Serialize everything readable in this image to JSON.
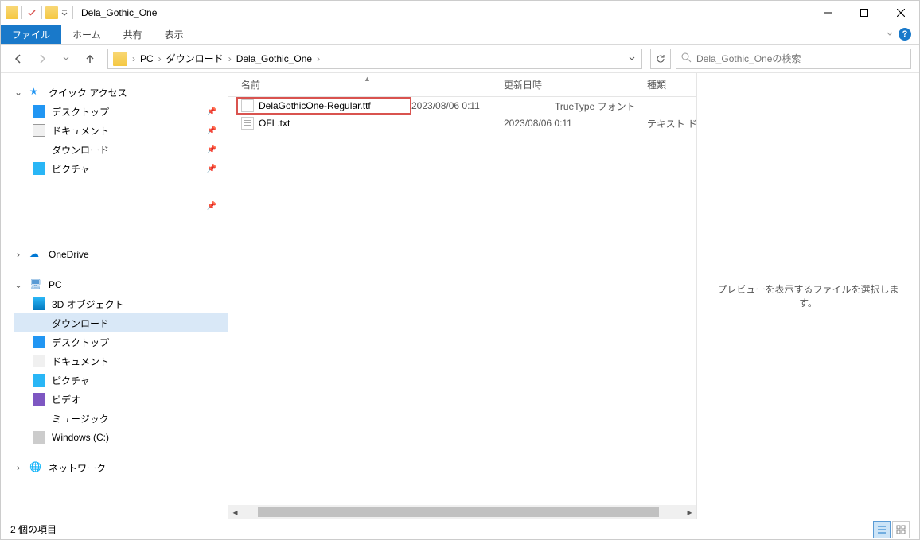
{
  "window": {
    "title": "Dela_Gothic_One"
  },
  "ribbon": {
    "file": "ファイル",
    "tabs": [
      "ホーム",
      "共有",
      "表示"
    ]
  },
  "address": {
    "crumbs": [
      "PC",
      "ダウンロード",
      "Dela_Gothic_One"
    ]
  },
  "search": {
    "placeholder": "Dela_Gothic_Oneの検索"
  },
  "nav": {
    "quick_access": "クイック アクセス",
    "quick_items": [
      {
        "label": "デスクトップ",
        "icon": "desktop",
        "pin": true
      },
      {
        "label": "ドキュメント",
        "icon": "doc",
        "pin": true
      },
      {
        "label": "ダウンロード",
        "icon": "dl",
        "pin": true
      },
      {
        "label": "ピクチャ",
        "icon": "pic",
        "pin": true
      }
    ],
    "onedrive": "OneDrive",
    "pc": "PC",
    "pc_items": [
      {
        "label": "3D オブジェクト",
        "icon": "obj3d"
      },
      {
        "label": "ダウンロード",
        "icon": "dl",
        "selected": true
      },
      {
        "label": "デスクトップ",
        "icon": "desktop"
      },
      {
        "label": "ドキュメント",
        "icon": "doc"
      },
      {
        "label": "ピクチャ",
        "icon": "pic"
      },
      {
        "label": "ビデオ",
        "icon": "video"
      },
      {
        "label": "ミュージック",
        "icon": "music"
      },
      {
        "label": "Windows  (C:)",
        "icon": "disk"
      }
    ],
    "network": "ネットワーク"
  },
  "columns": {
    "name": "名前",
    "date": "更新日時",
    "type": "種類"
  },
  "files": [
    {
      "name": "DelaGothicOne-Regular.ttf",
      "date": "2023/08/06 0:11",
      "type": "TrueType フォント",
      "icon": "font",
      "highlight": true
    },
    {
      "name": "OFL.txt",
      "date": "2023/08/06 0:11",
      "type": "テキスト ドキュメント",
      "icon": "txt",
      "highlight": false
    }
  ],
  "preview": {
    "empty": "プレビューを表示するファイルを選択します。"
  },
  "status": {
    "count": "2 個の項目"
  }
}
